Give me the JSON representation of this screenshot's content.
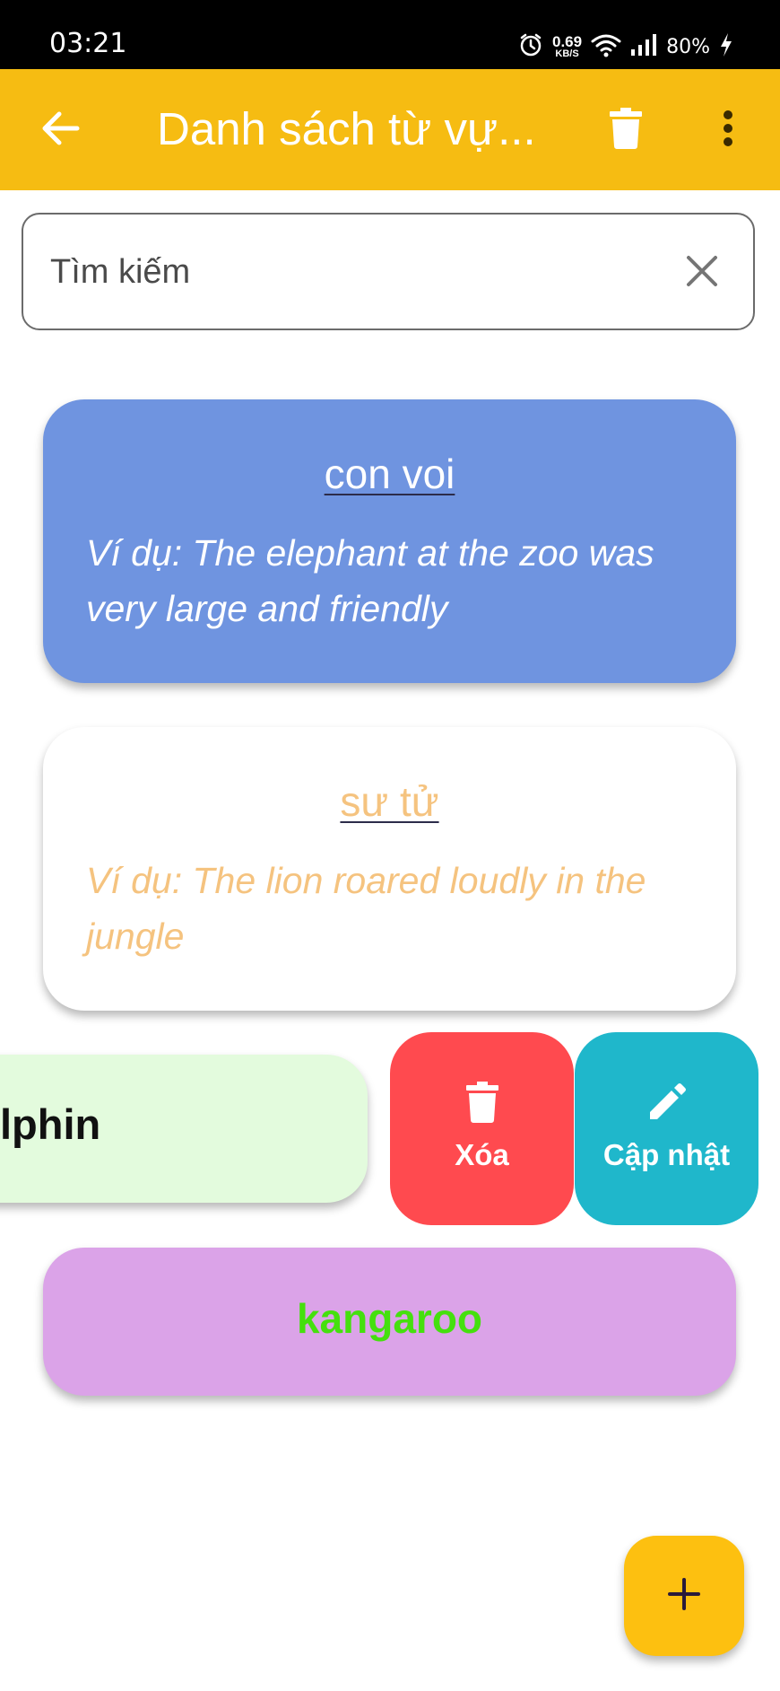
{
  "status_bar": {
    "time": "03:21",
    "net_speed_value": "0.69",
    "net_speed_unit": "KB/S",
    "battery": "80%"
  },
  "app_bar": {
    "title": "Danh sách từ vự...",
    "color": "#F6BC12"
  },
  "search": {
    "placeholder": "Tìm kiếm",
    "value": ""
  },
  "cards": [
    {
      "word": "con voi",
      "example": "Ví dụ: The elephant at the zoo was very large and friendly",
      "color": "#6F94E0"
    },
    {
      "word": "sư tử",
      "example": "Ví dụ: The lion roared loudly in the jungle",
      "color": "#FFFFFF"
    },
    {
      "word": "lphin",
      "color": "#E3FBDD"
    },
    {
      "word": "kangaroo",
      "color": "#DBA3E8"
    }
  ],
  "swipe_actions": {
    "delete_label": "Xóa",
    "update_label": "Cập nhật",
    "delete_color": "#FF4A4F",
    "update_color": "#1FB7CB"
  },
  "fab": {
    "icon": "plus-icon",
    "color": "#FDC010"
  },
  "icons": {
    "back": "arrow-left-icon",
    "delete_all": "trash-icon",
    "more": "more-vert-icon",
    "clear": "close-icon",
    "delete": "trash-icon",
    "update": "pencil-icon"
  }
}
